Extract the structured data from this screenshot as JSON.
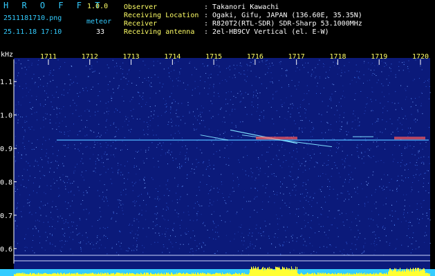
{
  "header": {
    "app_name": "H R O F F T",
    "app_version": "1.0.0",
    "filename": "2511181710.png",
    "datetime": "25.11.18 17:10",
    "count_label": "meteor",
    "count_value": "33",
    "info": [
      {
        "label": "Observer",
        "value": ": Takanori Kawachi"
      },
      {
        "label": "Receiving Location",
        "value": ": Ogaki, Gifu, JAPAN (136.60E, 35.35N)"
      },
      {
        "label": "Receiver",
        "value": ": R820T2(RTL-SDR) SDR-Sharp 53.1000MHz"
      },
      {
        "label": "Receiving antenna",
        "value": ": 2el-HB9CV Vertical (el. E-W)"
      }
    ]
  },
  "spectrogram": {
    "y_unit": "kHz",
    "y_ticks": [
      "1.1",
      "1.0",
      "0.9",
      "0.8",
      "0.7",
      "0.6"
    ],
    "time_ticks": [
      "1711",
      "1712",
      "1713",
      "1714",
      "1715",
      "1716",
      "1717",
      "1718",
      "1719",
      "1720"
    ],
    "colors": {
      "background": "#0b1a7a",
      "axis": "#ffffff",
      "level": "#ffff33",
      "noise_floor": "#33ccff"
    }
  }
}
